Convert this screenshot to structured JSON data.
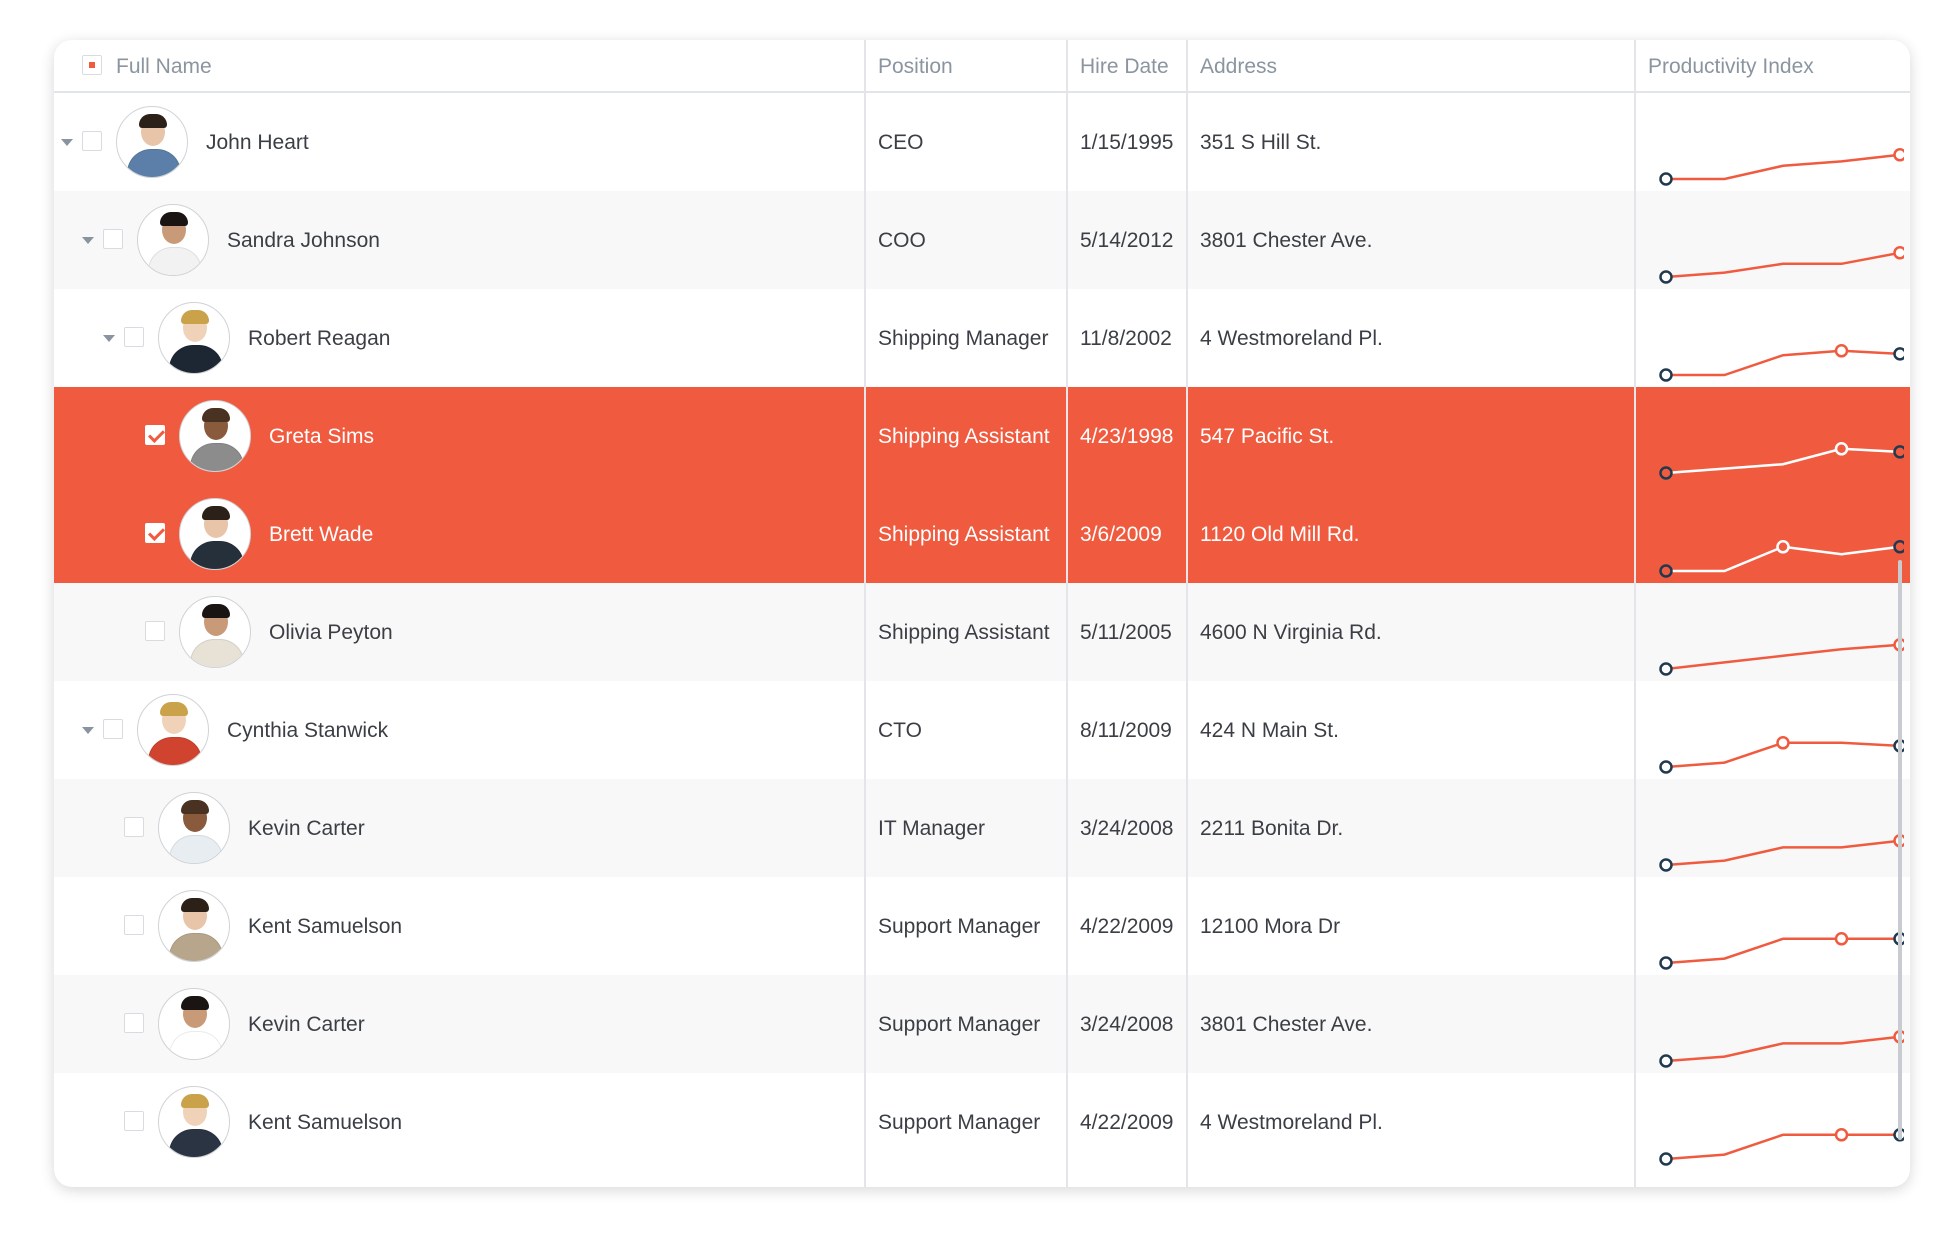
{
  "columns": {
    "full_name": "Full Name",
    "position": "Position",
    "hire_date": "Hire Date",
    "address": "Address",
    "productivity": "Productivity Index"
  },
  "colors": {
    "accent": "#f05b40",
    "dark_marker": "#1f3a4f"
  },
  "rows": [
    {
      "name": "John Heart",
      "position": "CEO",
      "hire_date": "1/15/1995",
      "address": "351 S Hill St.",
      "level": 0,
      "expandable": true,
      "checked": false,
      "productivity": [
        0,
        0,
        0.3,
        0.4,
        0.55
      ],
      "highlight": 4
    },
    {
      "name": "Sandra Johnson",
      "position": "COO",
      "hire_date": "5/14/2012",
      "address": "3801 Chester Ave.",
      "level": 1,
      "expandable": true,
      "checked": false,
      "productivity": [
        0,
        0.1,
        0.3,
        0.3,
        0.55
      ],
      "highlight": 4
    },
    {
      "name": "Robert Reagan",
      "position": "Shipping Manager",
      "hire_date": "11/8/2002",
      "address": "4 Westmoreland Pl.",
      "level": 2,
      "expandable": true,
      "checked": false,
      "productivity": [
        0,
        0,
        0.45,
        0.55,
        0.48
      ],
      "highlight": 3
    },
    {
      "name": "Greta Sims",
      "position": "Shipping Assistant",
      "hire_date": "4/23/1998",
      "address": "547 Pacific St.",
      "level": 3,
      "expandable": false,
      "checked": true,
      "productivity": [
        0,
        0.1,
        0.2,
        0.55,
        0.48
      ],
      "highlight": 3
    },
    {
      "name": "Brett Wade",
      "position": "Shipping Assistant",
      "hire_date": "3/6/2009",
      "address": "1120 Old Mill Rd.",
      "level": 3,
      "expandable": false,
      "checked": true,
      "productivity": [
        0,
        0,
        0.55,
        0.38,
        0.55
      ],
      "highlight": 2
    },
    {
      "name": "Olivia Peyton",
      "position": "Shipping Assistant",
      "hire_date": "5/11/2005",
      "address": "4600 N Virginia Rd.",
      "level": 3,
      "expandable": false,
      "checked": false,
      "productivity": [
        0,
        0.15,
        0.3,
        0.45,
        0.55
      ],
      "highlight": 4
    },
    {
      "name": "Cynthia Stanwick",
      "position": "CTO",
      "hire_date": "8/11/2009",
      "address": "424 N Main St.",
      "level": 1,
      "expandable": true,
      "checked": false,
      "productivity": [
        0,
        0.1,
        0.55,
        0.55,
        0.48
      ],
      "highlight": 2
    },
    {
      "name": "Kevin Carter",
      "position": "IT Manager",
      "hire_date": "3/24/2008",
      "address": "2211 Bonita Dr.",
      "level": 2,
      "expandable": false,
      "checked": false,
      "productivity": [
        0,
        0.1,
        0.4,
        0.4,
        0.55
      ],
      "highlight": 4
    },
    {
      "name": "Kent Samuelson",
      "position": "Support Manager",
      "hire_date": "4/22/2009",
      "address": "12100 Mora Dr",
      "level": 2,
      "expandable": false,
      "checked": false,
      "productivity": [
        0,
        0.1,
        0.55,
        0.55,
        0.55
      ],
      "highlight": 3
    },
    {
      "name": "Kevin Carter",
      "position": "Support Manager",
      "hire_date": "3/24/2008",
      "address": "3801 Chester Ave.",
      "level": 2,
      "expandable": false,
      "checked": false,
      "productivity": [
        0,
        0.1,
        0.4,
        0.4,
        0.55
      ],
      "highlight": 4
    },
    {
      "name": "Kent Samuelson",
      "position": "Support Manager",
      "hire_date": "4/22/2009",
      "address": "4 Westmoreland Pl.",
      "level": 2,
      "expandable": false,
      "checked": false,
      "productivity": [
        0,
        0.1,
        0.55,
        0.55,
        0.55
      ],
      "highlight": 3
    }
  ]
}
